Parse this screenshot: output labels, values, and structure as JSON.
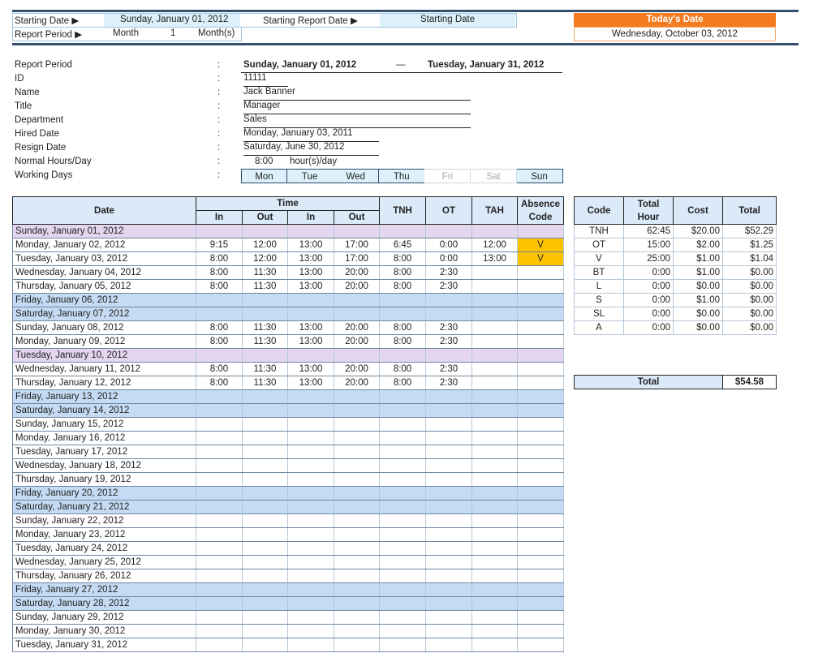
{
  "top": {
    "starting_date_label": "Starting Date ▶",
    "starting_date": "Sunday, January 01, 2012",
    "starting_report_label": "Starting Report Date ▶",
    "starting_report_value": "Starting Date",
    "report_period_label": "Report Period ▶",
    "period_unit": "Month",
    "period_count": "1",
    "period_suffix": "Month(s)",
    "today_label": "Today's Date",
    "today_value": "Wednesday, October 03, 2012"
  },
  "info": {
    "report_period_label": "Report Period",
    "report_start": "Sunday, January 01, 2012",
    "dash": "—",
    "report_end": "Tuesday, January 31, 2012",
    "id_label": "ID",
    "id": "11111",
    "name_label": "Name",
    "name": "Jack Banner",
    "title_label": "Title",
    "title": "Manager",
    "department_label": "Department",
    "department": "Sales",
    "hired_label": "Hired Date",
    "hired": "Monday, January 03, 2011",
    "resign_label": "Resign Date",
    "resign": "Saturday, June 30, 2012",
    "hours_label": "Normal Hours/Day",
    "hours": "8:00",
    "hours_unit": "hour(s)/day",
    "working_days_label": "Working Days",
    "colon": ":",
    "working_days": [
      {
        "d": "Mon",
        "on": true
      },
      {
        "d": "Tue",
        "on": true
      },
      {
        "d": "Wed",
        "on": true
      },
      {
        "d": "Thu",
        "on": true
      },
      {
        "d": "Fri",
        "on": false
      },
      {
        "d": "Sat",
        "on": false
      },
      {
        "d": "Sun",
        "on": true
      }
    ]
  },
  "timesheet": {
    "headers": {
      "date": "Date",
      "time": "Time",
      "in": "In",
      "out": "Out",
      "tnh": "TNH",
      "ot": "OT",
      "tah": "TAH",
      "absence": "Absence Code"
    },
    "colors": {
      "weekend": "#c5dbf3",
      "holiday": "#e4d6ef",
      "absence": "#fdc300"
    },
    "rows": [
      {
        "date": "Sunday, January 01, 2012",
        "type": "holiday",
        "v": [
          "",
          "",
          "",
          "",
          "",
          "",
          "",
          ""
        ]
      },
      {
        "date": "Monday, January 02, 2012",
        "v": [
          "9:15",
          "12:00",
          "13:00",
          "17:00",
          "6:45",
          "0:00",
          "12:00",
          "V"
        ]
      },
      {
        "date": "Tuesday, January 03, 2012",
        "v": [
          "8:00",
          "12:00",
          "13:00",
          "17:00",
          "8:00",
          "0:00",
          "13:00",
          "V"
        ]
      },
      {
        "date": "Wednesday, January 04, 2012",
        "v": [
          "8:00",
          "11:30",
          "13:00",
          "20:00",
          "8:00",
          "2:30",
          "",
          ""
        ]
      },
      {
        "date": "Thursday, January 05, 2012",
        "v": [
          "8:00",
          "11:30",
          "13:00",
          "20:00",
          "8:00",
          "2:30",
          "",
          ""
        ]
      },
      {
        "date": "Friday, January 06, 2012",
        "type": "weekend",
        "v": [
          "",
          "",
          "",
          "",
          "",
          "",
          "",
          ""
        ]
      },
      {
        "date": "Saturday, January 07, 2012",
        "type": "weekend",
        "v": [
          "",
          "",
          "",
          "",
          "",
          "",
          "",
          ""
        ]
      },
      {
        "date": "Sunday, January 08, 2012",
        "v": [
          "8:00",
          "11:30",
          "13:00",
          "20:00",
          "8:00",
          "2:30",
          "",
          ""
        ]
      },
      {
        "date": "Monday, January 09, 2012",
        "v": [
          "8:00",
          "11:30",
          "13:00",
          "20:00",
          "8:00",
          "2:30",
          "",
          ""
        ]
      },
      {
        "date": "Tuesday, January 10, 2012",
        "type": "holiday",
        "v": [
          "",
          "",
          "",
          "",
          "",
          "",
          "",
          ""
        ]
      },
      {
        "date": "Wednesday, January 11, 2012",
        "v": [
          "8:00",
          "11:30",
          "13:00",
          "20:00",
          "8:00",
          "2:30",
          "",
          ""
        ]
      },
      {
        "date": "Thursday, January 12, 2012",
        "v": [
          "8:00",
          "11:30",
          "13:00",
          "20:00",
          "8:00",
          "2:30",
          "",
          ""
        ]
      },
      {
        "date": "Friday, January 13, 2012",
        "type": "weekend",
        "v": [
          "",
          "",
          "",
          "",
          "",
          "",
          "",
          ""
        ]
      },
      {
        "date": "Saturday, January 14, 2012",
        "type": "weekend",
        "v": [
          "",
          "",
          "",
          "",
          "",
          "",
          "",
          ""
        ]
      },
      {
        "date": "Sunday, January 15, 2012",
        "v": [
          "",
          "",
          "",
          "",
          "",
          "",
          "",
          ""
        ]
      },
      {
        "date": "Monday, January 16, 2012",
        "v": [
          "",
          "",
          "",
          "",
          "",
          "",
          "",
          ""
        ]
      },
      {
        "date": "Tuesday, January 17, 2012",
        "v": [
          "",
          "",
          "",
          "",
          "",
          "",
          "",
          ""
        ]
      },
      {
        "date": "Wednesday, January 18, 2012",
        "v": [
          "",
          "",
          "",
          "",
          "",
          "",
          "",
          ""
        ]
      },
      {
        "date": "Thursday, January 19, 2012",
        "v": [
          "",
          "",
          "",
          "",
          "",
          "",
          "",
          ""
        ]
      },
      {
        "date": "Friday, January 20, 2012",
        "type": "weekend",
        "v": [
          "",
          "",
          "",
          "",
          "",
          "",
          "",
          ""
        ]
      },
      {
        "date": "Saturday, January 21, 2012",
        "type": "weekend",
        "v": [
          "",
          "",
          "",
          "",
          "",
          "",
          "",
          ""
        ]
      },
      {
        "date": "Sunday, January 22, 2012",
        "v": [
          "",
          "",
          "",
          "",
          "",
          "",
          "",
          ""
        ]
      },
      {
        "date": "Monday, January 23, 2012",
        "v": [
          "",
          "",
          "",
          "",
          "",
          "",
          "",
          ""
        ]
      },
      {
        "date": "Tuesday, January 24, 2012",
        "v": [
          "",
          "",
          "",
          "",
          "",
          "",
          "",
          ""
        ]
      },
      {
        "date": "Wednesday, January 25, 2012",
        "v": [
          "",
          "",
          "",
          "",
          "",
          "",
          "",
          ""
        ]
      },
      {
        "date": "Thursday, January 26, 2012",
        "v": [
          "",
          "",
          "",
          "",
          "",
          "",
          "",
          ""
        ]
      },
      {
        "date": "Friday, January 27, 2012",
        "type": "weekend",
        "v": [
          "",
          "",
          "",
          "",
          "",
          "",
          "",
          ""
        ]
      },
      {
        "date": "Saturday, January 28, 2012",
        "type": "weekend",
        "v": [
          "",
          "",
          "",
          "",
          "",
          "",
          "",
          ""
        ]
      },
      {
        "date": "Sunday, January 29, 2012",
        "v": [
          "",
          "",
          "",
          "",
          "",
          "",
          "",
          ""
        ]
      },
      {
        "date": "Monday, January 30, 2012",
        "v": [
          "",
          "",
          "",
          "",
          "",
          "",
          "",
          ""
        ]
      },
      {
        "date": "Tuesday, January 31, 2012",
        "v": [
          "",
          "",
          "",
          "",
          "",
          "",
          "",
          ""
        ]
      }
    ]
  },
  "cost": {
    "headers": {
      "code": "Code",
      "hour": "Total Hour",
      "cost": "Cost",
      "total": "Total"
    },
    "rows": [
      [
        "TNH",
        "62:45",
        "$20.00",
        "$52.29"
      ],
      [
        "OT",
        "15:00",
        "$2.00",
        "$1.25"
      ],
      [
        "V",
        "25:00",
        "$1.00",
        "$1.04"
      ],
      [
        "BT",
        "0:00",
        "$1.00",
        "$0.00"
      ],
      [
        "L",
        "0:00",
        "$0.00",
        "$0.00"
      ],
      [
        "S",
        "0:00",
        "$1.00",
        "$0.00"
      ],
      [
        "SL",
        "0:00",
        "$0.00",
        "$0.00"
      ],
      [
        "A",
        "0:00",
        "$0.00",
        "$0.00"
      ]
    ],
    "grand_total_label": "Total",
    "grand_total": "$54.58"
  }
}
